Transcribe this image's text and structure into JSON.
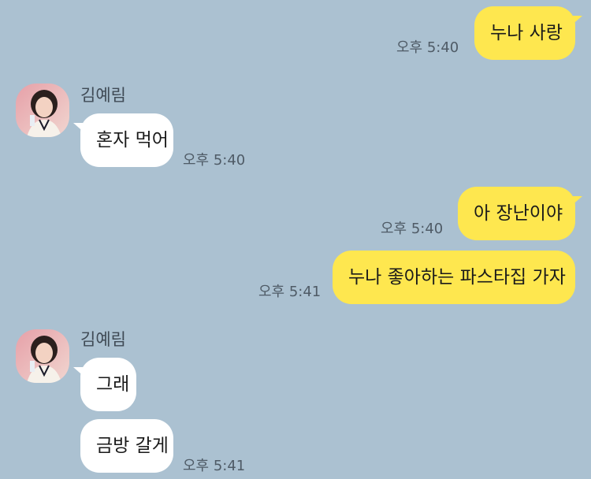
{
  "chat": {
    "messages": [
      {
        "sender": "me",
        "text": "누나 사랑",
        "time": "오후 5:40"
      },
      {
        "sender": "them",
        "name": "김예림",
        "text": "혼자 먹어",
        "time": "오후 5:40"
      },
      {
        "sender": "me",
        "text": "아 장난이야",
        "time": "오후 5:40"
      },
      {
        "sender": "me",
        "text": "누나 좋아하는 파스타집 가자",
        "time": "오후 5:41"
      },
      {
        "sender": "them",
        "name": "김예림",
        "text": "그래",
        "time": ""
      },
      {
        "sender": "them",
        "text": "금방 갈게",
        "time": "오후 5:41"
      }
    ]
  },
  "colors": {
    "background": "#abc1d1",
    "my_bubble": "#fee74f",
    "their_bubble": "#ffffff",
    "time_text": "#4f5b66"
  },
  "icons": {
    "avatar": "profile-photo"
  }
}
